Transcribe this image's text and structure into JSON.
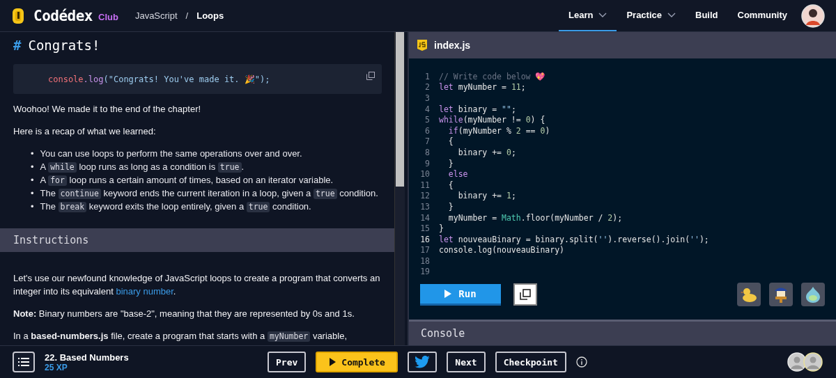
{
  "header": {
    "logo": "Codédex",
    "logo_badge": "Club",
    "breadcrumb": [
      {
        "label": "JavaScript",
        "current": false
      },
      {
        "label": "Loops",
        "current": true
      }
    ],
    "breadcrumb_separator": "/",
    "nav": [
      {
        "label": "Learn",
        "dropdown": true,
        "selected": true
      },
      {
        "label": "Practice",
        "dropdown": true,
        "selected": false
      },
      {
        "label": "Build",
        "dropdown": false,
        "selected": false
      },
      {
        "label": "Community",
        "dropdown": false,
        "selected": false
      }
    ]
  },
  "lesson": {
    "heading_mark": "#",
    "heading": "Congrats!",
    "snippet": [
      {
        "text": "console",
        "kind": "obj"
      },
      {
        "text": ".log",
        "kind": "fn"
      },
      {
        "text": "(\"Congrats! You've made it. 🎉\");",
        "kind": "str"
      }
    ],
    "paragraphs": [
      "Woohoo! We made it to the end of the chapter!",
      "Here is a recap of what we learned:"
    ],
    "bullet": "•",
    "recap": [
      [
        {
          "kind": "text",
          "s": "You can use loops to perform the same operations over and over."
        }
      ],
      [
        {
          "kind": "text",
          "s": "A "
        },
        {
          "kind": "code",
          "s": "while"
        },
        {
          "kind": "text",
          "s": " loop runs as long as a condition is "
        },
        {
          "kind": "code",
          "s": "true"
        },
        {
          "kind": "text",
          "s": "."
        }
      ],
      [
        {
          "kind": "text",
          "s": "A "
        },
        {
          "kind": "code",
          "s": "for"
        },
        {
          "kind": "text",
          "s": " loop runs a certain amount of times, based on an iterator variable."
        }
      ],
      [
        {
          "kind": "text",
          "s": "The "
        },
        {
          "kind": "code",
          "s": "continue"
        },
        {
          "kind": "text",
          "s": " keyword ends the current iteration in a loop, given a "
        },
        {
          "kind": "code",
          "s": "true"
        },
        {
          "kind": "text",
          "s": " condition."
        }
      ],
      [
        {
          "kind": "text",
          "s": "The "
        },
        {
          "kind": "code",
          "s": "break"
        },
        {
          "kind": "text",
          "s": " keyword exits the loop entirely, given a "
        },
        {
          "kind": "code",
          "s": "true"
        },
        {
          "kind": "text",
          "s": " condition."
        }
      ]
    ],
    "instructions_title": "Instructions",
    "instructions": [
      [
        {
          "kind": "text",
          "s": "Let's use our newfound knowledge of JavaScript loops to create a program that converts an integer into its equivalent "
        },
        {
          "kind": "link",
          "s": "binary number"
        },
        {
          "kind": "text",
          "s": "."
        }
      ],
      [
        {
          "kind": "text",
          "s": "**Note:** Binary numbers are \"base-2\", meaning that they are represented by 0s and 1s."
        }
      ],
      [
        {
          "kind": "text",
          "s": "In a **based-numbers.js** file, create a program that starts with a "
        },
        {
          "kind": "code",
          "s": "myNumber"
        },
        {
          "kind": "text",
          "s": " variable,"
        }
      ]
    ]
  },
  "editor": {
    "file": "index.js",
    "lines": [
      {
        "n": "1",
        "active": false,
        "tokens": [
          {
            "text": "// Write code below 💖",
            "kind": "comment"
          }
        ]
      },
      {
        "n": "2",
        "active": false,
        "tokens": [
          {
            "text": "let",
            "kind": "kw"
          },
          {
            "text": " myNumber = ",
            "kind": "plain"
          },
          {
            "text": "11",
            "kind": "num"
          },
          {
            "text": ";",
            "kind": "plain"
          }
        ]
      },
      {
        "n": "3",
        "active": false
      },
      {
        "n": "4",
        "active": false,
        "tokens": [
          {
            "text": "let",
            "kind": "kw"
          },
          {
            "text": " binary = ",
            "kind": "plain"
          },
          {
            "text": "\"\"",
            "kind": "str"
          },
          {
            "text": ";",
            "kind": "plain"
          }
        ]
      },
      {
        "n": "5",
        "active": false,
        "tokens": [
          {
            "text": "while",
            "kind": "kw"
          },
          {
            "text": "(myNumber != ",
            "kind": "plain"
          },
          {
            "text": "0",
            "kind": "num"
          },
          {
            "text": ") {",
            "kind": "plain"
          }
        ]
      },
      {
        "n": "6",
        "active": false,
        "tokens": [
          {
            "text": "  if",
            "kind": "kw"
          },
          {
            "text": "(myNumber % ",
            "kind": "plain"
          },
          {
            "text": "2",
            "kind": "num"
          },
          {
            "text": " == ",
            "kind": "plain"
          },
          {
            "text": "0",
            "kind": "num"
          },
          {
            "text": ")",
            "kind": "plain"
          }
        ]
      },
      {
        "n": "7",
        "active": false,
        "tokens": [
          {
            "text": "  {",
            "kind": "plain"
          }
        ]
      },
      {
        "n": "8",
        "active": false,
        "tokens": [
          {
            "text": "    binary += ",
            "kind": "plain"
          },
          {
            "text": "0",
            "kind": "num"
          },
          {
            "text": ";",
            "kind": "plain"
          }
        ]
      },
      {
        "n": "9",
        "active": false,
        "tokens": [
          {
            "text": "  }",
            "kind": "plain"
          }
        ]
      },
      {
        "n": "10",
        "active": false,
        "tokens": [
          {
            "text": "  else",
            "kind": "kw"
          }
        ]
      },
      {
        "n": "11",
        "active": false,
        "tokens": [
          {
            "text": "  {",
            "kind": "plain"
          }
        ]
      },
      {
        "n": "12",
        "active": false,
        "tokens": [
          {
            "text": "    binary += ",
            "kind": "plain"
          },
          {
            "text": "1",
            "kind": "num"
          },
          {
            "text": ";",
            "kind": "plain"
          }
        ]
      },
      {
        "n": "13",
        "active": false,
        "tokens": [
          {
            "text": "  }",
            "kind": "plain"
          }
        ]
      },
      {
        "n": "14",
        "active": false,
        "tokens": [
          {
            "text": "  myNumber = ",
            "kind": "plain"
          },
          {
            "text": "Math",
            "kind": "cls"
          },
          {
            "text": ".floor(myNumber / ",
            "kind": "plain"
          },
          {
            "text": "2",
            "kind": "num"
          },
          {
            "text": ");",
            "kind": "plain"
          }
        ]
      },
      {
        "n": "15",
        "active": false,
        "tokens": [
          {
            "text": "}",
            "kind": "plain"
          }
        ]
      },
      {
        "n": "16",
        "active": true,
        "tokens": [
          {
            "text": "let",
            "kind": "kw"
          },
          {
            "text": " nouveauBinary = binary.split(",
            "kind": "plain"
          },
          {
            "text": "''",
            "kind": "str"
          },
          {
            "text": ").reverse().join(",
            "kind": "plain"
          },
          {
            "text": "''",
            "kind": "str"
          },
          {
            "text": ");",
            "kind": "plain"
          }
        ]
      },
      {
        "n": "17",
        "active": false,
        "tokens": [
          {
            "text": "console.log(nouveauBinary)",
            "kind": "plain"
          }
        ]
      },
      {
        "n": "18",
        "active": false
      },
      {
        "n": "19",
        "active": false
      }
    ],
    "run_label": "Run",
    "console_title": "Console"
  },
  "footer": {
    "lesson_title": "22. Based Numbers",
    "xp": "25 XP",
    "buttons": [
      {
        "label": "Prev",
        "kind": "plain"
      },
      {
        "label": "Complete",
        "kind": "primary"
      },
      {
        "kind": "twitter"
      },
      {
        "label": "Next",
        "kind": "plain"
      },
      {
        "label": "Checkpoint",
        "kind": "plain"
      }
    ]
  }
}
